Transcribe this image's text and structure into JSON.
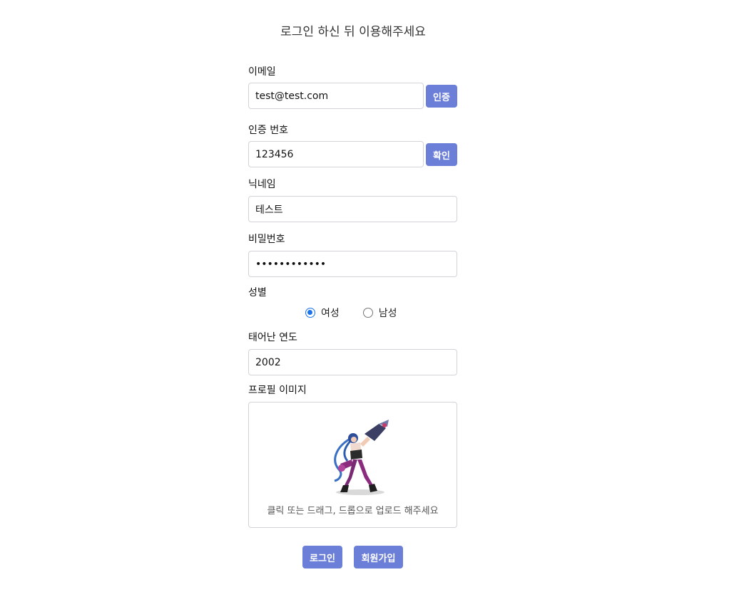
{
  "page": {
    "title": "로그인 하신 뒤 이용해주세요"
  },
  "form": {
    "email": {
      "label": "이메일",
      "value": "test@test.com",
      "button": "인증"
    },
    "code": {
      "label": "인증 번호",
      "value": "123456",
      "button": "확인"
    },
    "nickname": {
      "label": "닉네임",
      "value": "테스트"
    },
    "password": {
      "label": "비밀번호",
      "value": "............"
    },
    "gender": {
      "label": "성별",
      "options": [
        {
          "label": "여성",
          "checked": true
        },
        {
          "label": "남성",
          "checked": false
        }
      ]
    },
    "birth_year": {
      "label": "태어난 연도",
      "value": "2002"
    },
    "profile_image": {
      "label": "프로필 이미지",
      "hint": "클릭 또는 드래그, 드롭으로 업로드 해주세요",
      "image": "champion-character-avatar"
    }
  },
  "actions": {
    "login": "로그인",
    "signup": "회원가입"
  },
  "colors": {
    "accent": "#6c7fd8",
    "radio": "#1a73e8",
    "border": "#d4d4d8"
  }
}
